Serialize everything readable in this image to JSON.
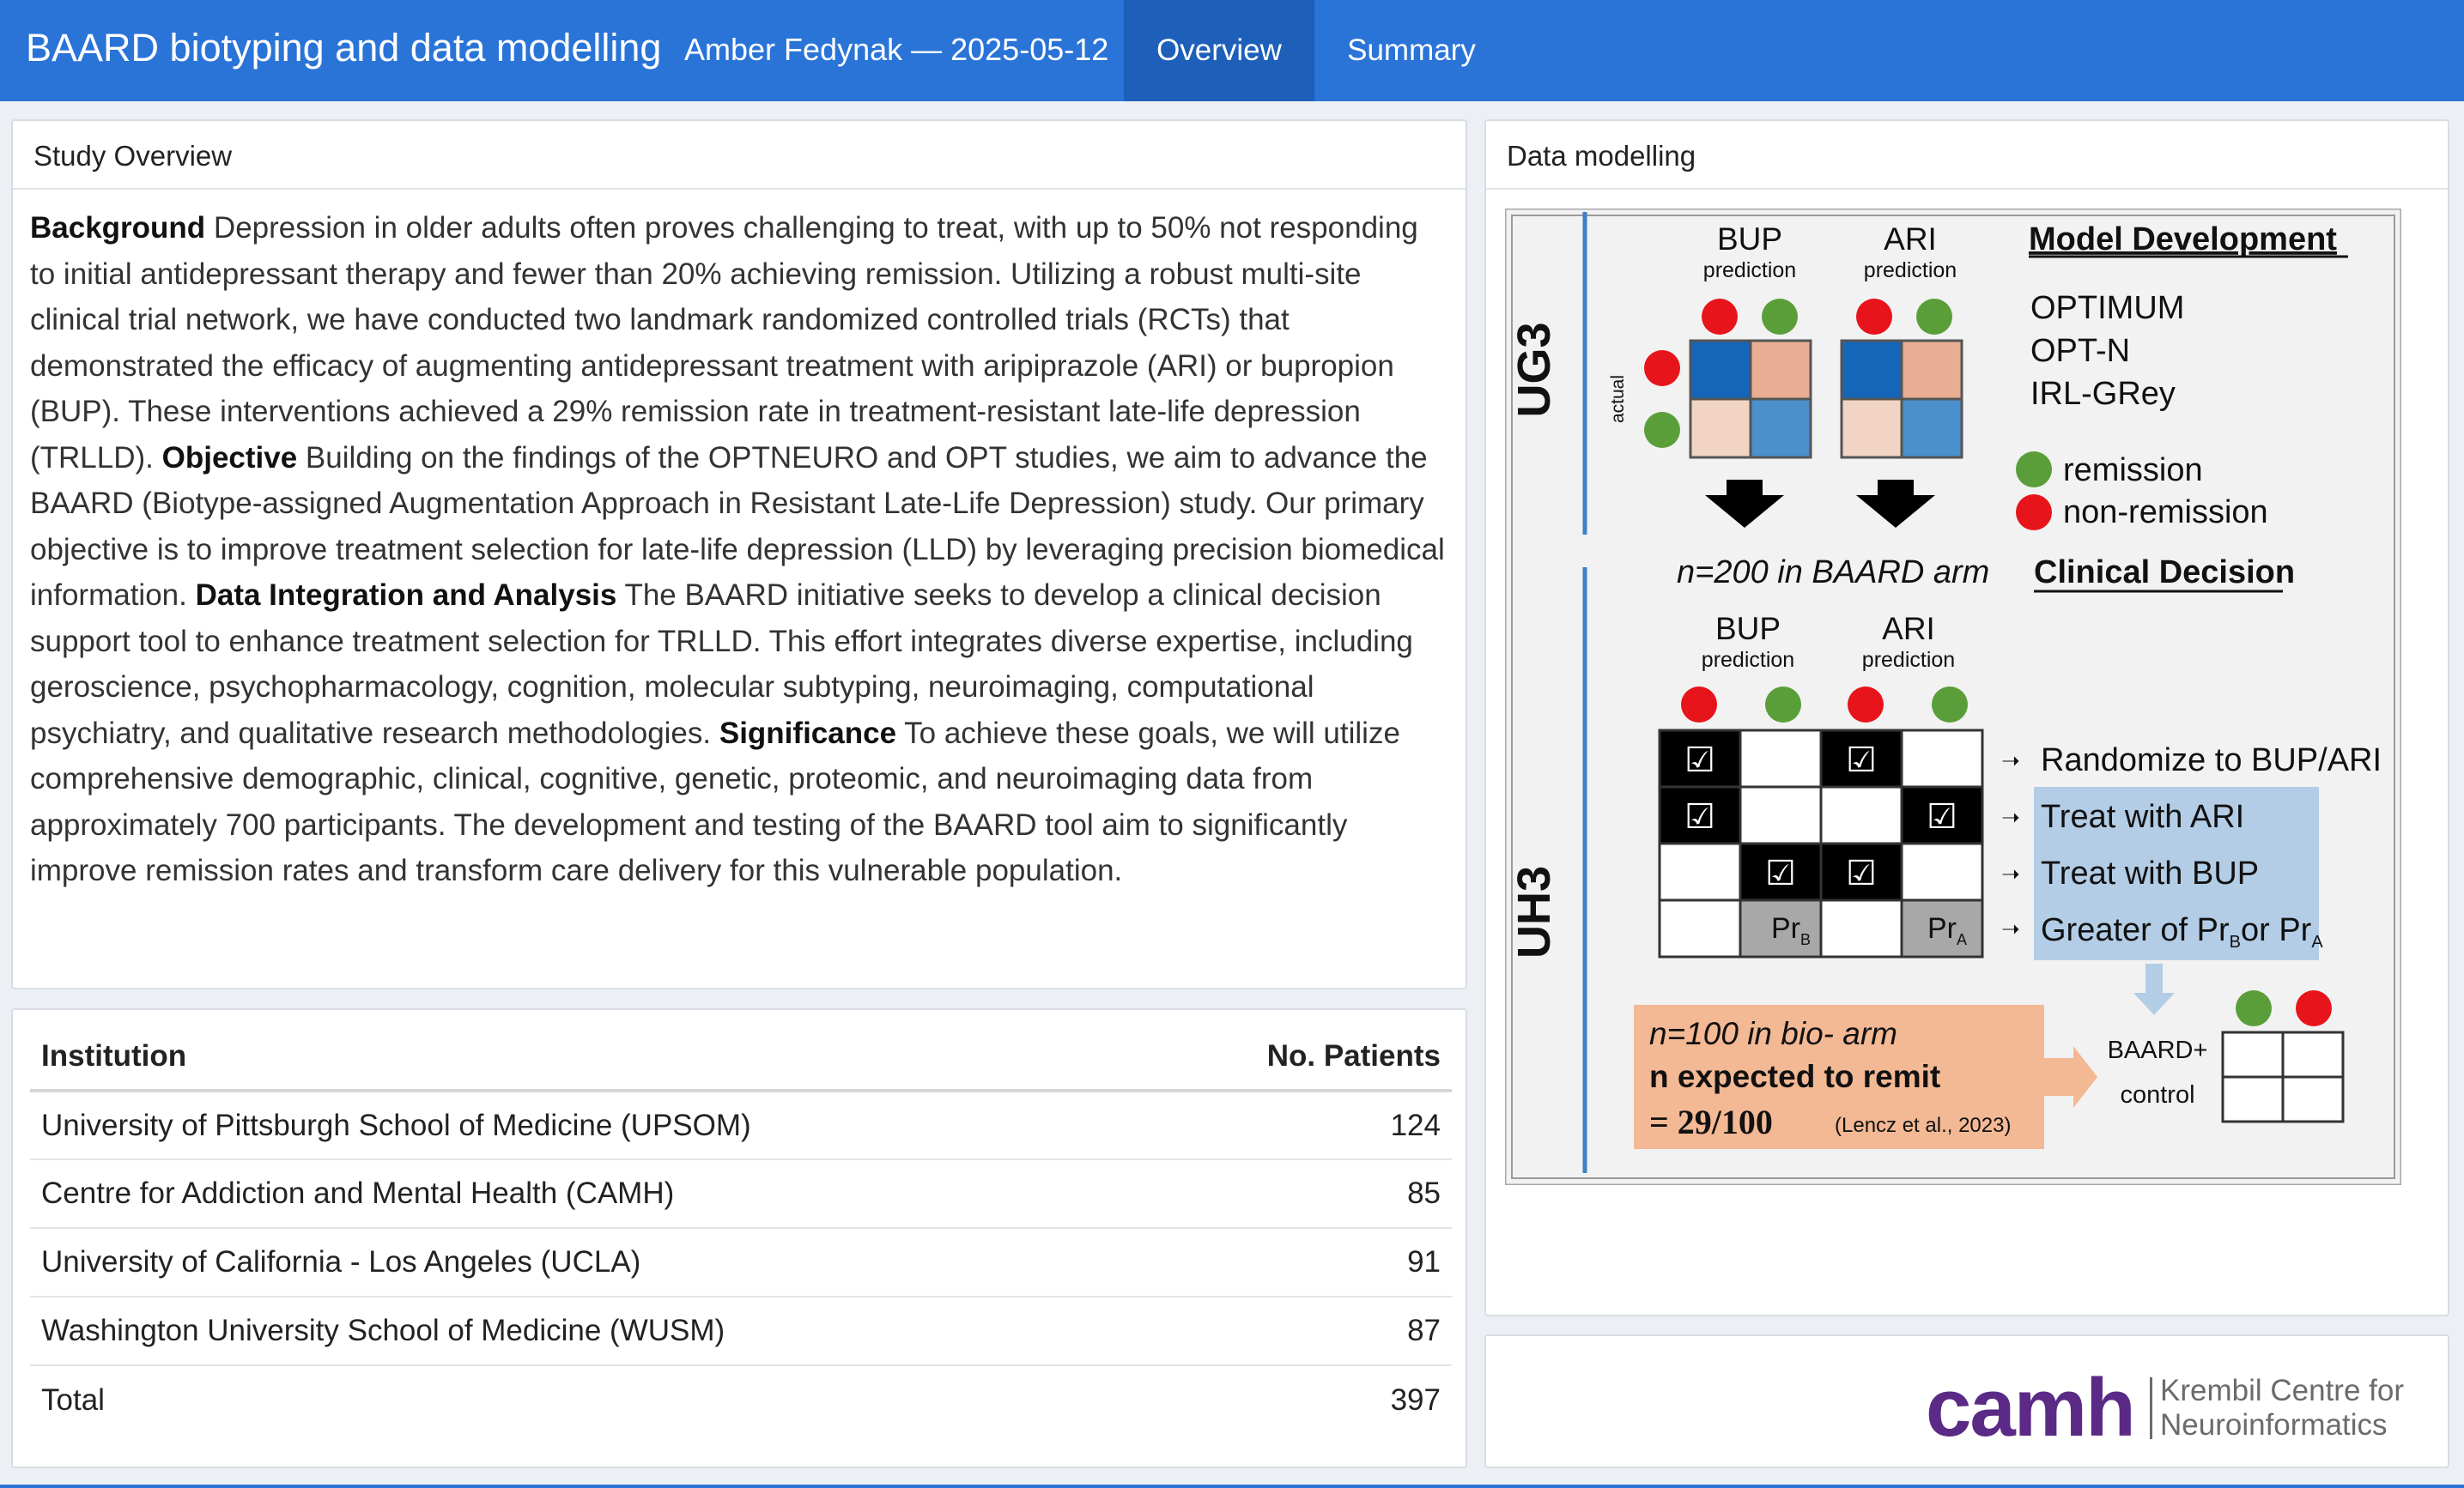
{
  "navbar": {
    "title": "BAARD biotyping and data modelling",
    "subtitle": "Amber Fedynak — 2025-05-12",
    "tabs": [
      {
        "label": "Overview",
        "active": true
      },
      {
        "label": "Summary",
        "active": false
      }
    ]
  },
  "study": {
    "header": "Study Overview",
    "sections": [
      {
        "heading": "Background",
        "text": " Depression in older adults often proves challenging to treat, with up to 50% not responding to initial antidepressant therapy and fewer than 20% achieving remission. Utilizing a robust multi-site clinical trial network, we have conducted two landmark randomized controlled trials (RCTs) that demonstrated the efficacy of augmenting antidepressant treatment with aripiprazole (ARI) or bupropion (BUP). These interventions achieved a 29% remission rate in treatment-resistant late-life depression (TRLLD). "
      },
      {
        "heading": "Objective",
        "text": " Building on the findings of the OPTNEURO and OPT studies, we aim to advance the BAARD (Biotype-assigned Augmentation Approach in Resistant Late-Life Depression) study. Our primary objective is to improve treatment selection for late-life depression (LLD) by leveraging precision biomedical information. "
      },
      {
        "heading": "Data Integration and Analysis",
        "text": " The BAARD initiative seeks to develop a clinical decision support tool to enhance treatment selection for TRLLD. This effort integrates diverse expertise, including geroscience, psychopharmacology, cognition, molecular subtyping, neuroimaging, computational psychiatry, and qualitative research methodologies. "
      },
      {
        "heading": "Significance",
        "text": " To achieve these goals, we will utilize comprehensive demographic, clinical, cognitive, genetic, proteomic, and neuroimaging data from approximately 700 participants. The development and testing of the BAARD tool aim to significantly improve remission rates and transform care delivery for this vulnerable population."
      }
    ]
  },
  "table": {
    "columns": [
      "Institution",
      "No. Patients"
    ],
    "rows": [
      {
        "institution": "University of Pittsburgh School of Medicine (UPSOM)",
        "patients": "124"
      },
      {
        "institution": "Centre for Addiction and Mental Health (CAMH)",
        "patients": "85"
      },
      {
        "institution": "University of California - Los Angeles (UCLA)",
        "patients": "91"
      },
      {
        "institution": "Washington University School of Medicine (WUSM)",
        "patients": "87"
      },
      {
        "institution": "Total",
        "patients": "397"
      }
    ]
  },
  "modelling": {
    "header": "Data modelling",
    "figure": {
      "ug3_label": "UG3",
      "uh3_label": "UH3",
      "bup": "BUP",
      "ari": "ARI",
      "prediction": "prediction",
      "actual": "actual",
      "model_title": "Model Development",
      "models": [
        "OPTIMUM",
        "OPT-N",
        "IRL-GRey"
      ],
      "legend_remission": "remission",
      "legend_nonremission": "non-remission",
      "n_baard": "n=200 in BAARD arm",
      "clinical_title": "Clinical Decision",
      "decisions": [
        "Randomize to BUP/ARI",
        "Treat with ARI",
        "Treat with BUP",
        "Greater of Pr",
        "or Pr"
      ],
      "sub_b": "B",
      "sub_a": "A",
      "pr": "Pr",
      "n_bio": "n=100 in bio- arm",
      "n_expected": "n expected to remit",
      "eq": "= 29/100",
      "citation": "(Lencz et al., 2023)",
      "baard_plus": "BAARD+",
      "control": "control",
      "checkmark": "☑",
      "colors": {
        "green": "#5a9e3a",
        "red": "#e8141b",
        "blue_dark": "#1565b8",
        "blue_light": "#4a90cc",
        "salmon": "#e8ae94",
        "salmon_light": "#f2d4c4",
        "orange_box": "#f3b894",
        "decision_blue": "#b3cde6"
      }
    }
  },
  "logo": {
    "name": "camh",
    "line1": "Krembil Centre for",
    "line2": "Neuroinformatics"
  },
  "colors": {
    "navbar": "#2a74d8",
    "navbar_active": "#1d5fb9"
  }
}
